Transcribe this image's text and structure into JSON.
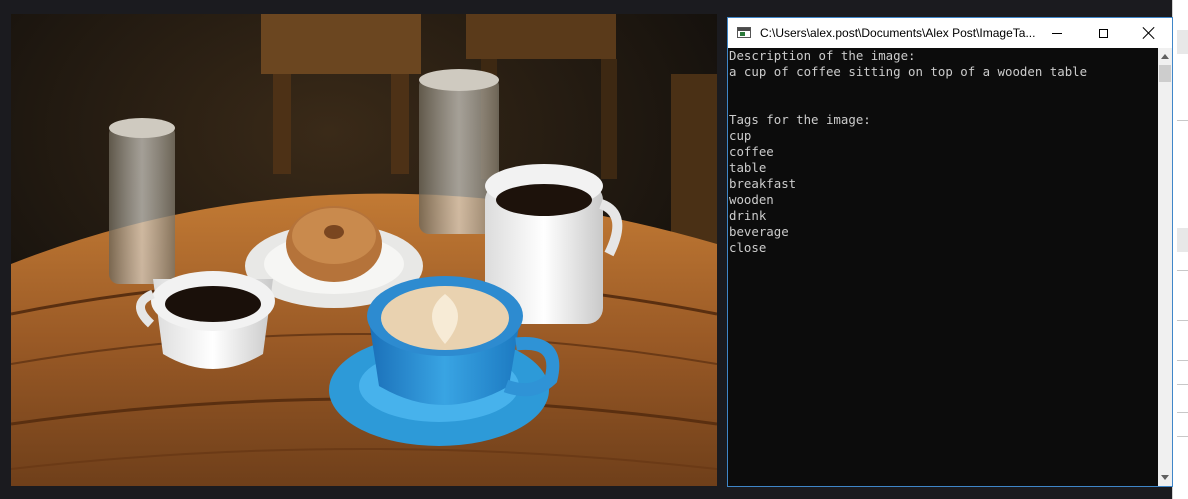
{
  "console": {
    "title": "C:\\Users\\alex.post\\Documents\\Alex Post\\ImageTa...",
    "lines": [
      "Description of the image:",
      "a cup of coffee sitting on top of a wooden table",
      "",
      "",
      "Tags for the image:",
      "cup",
      "coffee",
      "table",
      "breakfast",
      "wooden",
      "drink",
      "beverage",
      "close"
    ],
    "icons": {
      "app": "console-app-icon",
      "minimize": "minimize-icon",
      "maximize": "maximize-icon",
      "close": "close-icon"
    }
  },
  "colors": {
    "desktop": "#1b1b1f",
    "console_bg": "#0c0c0c",
    "console_text": "#cccccc",
    "window_border": "#3f86c8",
    "titlebar": "#ffffff"
  }
}
